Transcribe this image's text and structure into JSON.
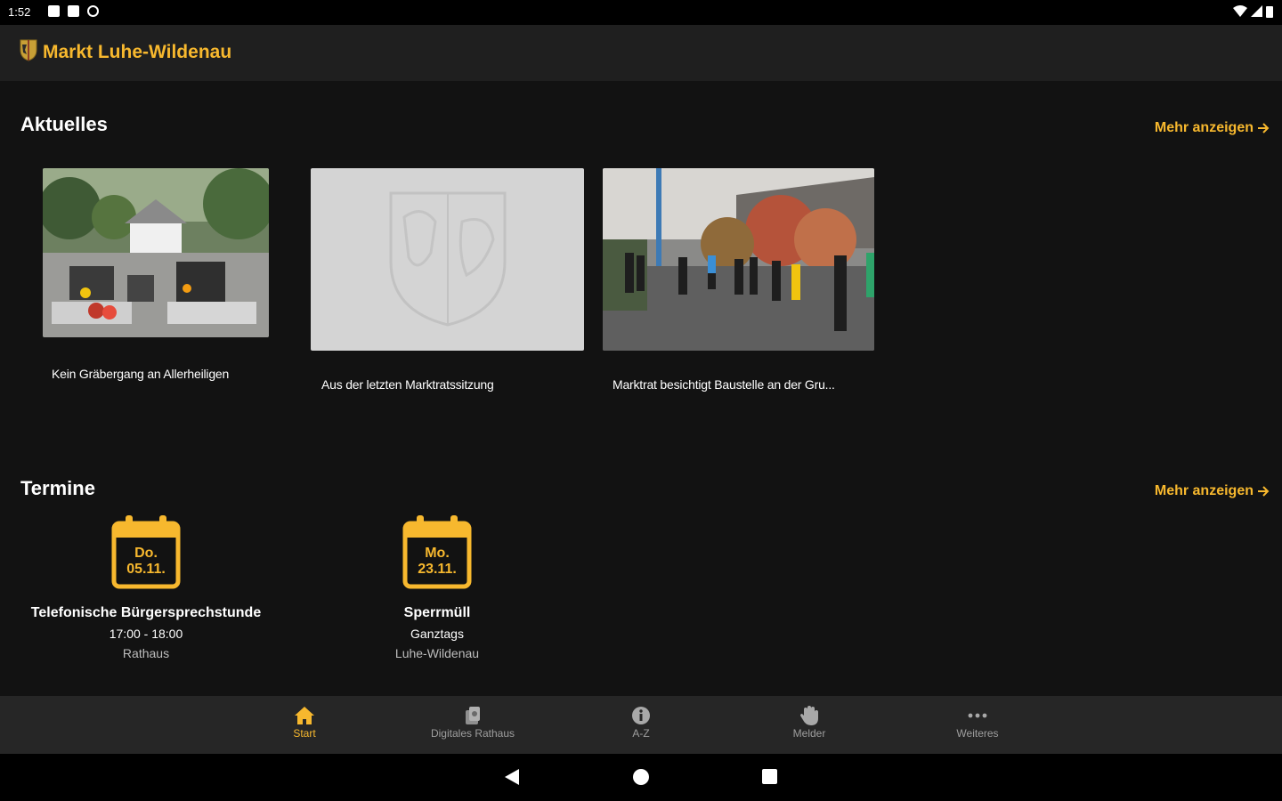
{
  "status_bar": {
    "time": "1:52"
  },
  "app_bar": {
    "title": "Markt Luhe-Wildenau"
  },
  "news": {
    "section_title": "Aktuelles",
    "more_label": "Mehr anzeigen",
    "items": [
      {
        "caption": "Kein Gräbergang an Allerheiligen"
      },
      {
        "caption": "Aus der letzten Marktratssitzung"
      },
      {
        "caption": "Marktrat besichtigt Baustelle an der Gru..."
      }
    ]
  },
  "events": {
    "section_title": "Termine",
    "more_label": "Mehr anzeigen",
    "items": [
      {
        "day": "Do.",
        "date": "05.11.",
        "title": "Telefonische Bürgersprechstunde",
        "time": "17:00 - 18:00",
        "location": "Rathaus"
      },
      {
        "day": "Mo.",
        "date": "23.11.",
        "title": "Sperrmüll",
        "time": "Ganztags",
        "location": "Luhe-Wildenau"
      }
    ]
  },
  "bottom_nav": {
    "items": [
      {
        "label": "Start",
        "icon": "home-icon",
        "active": true
      },
      {
        "label": "Digitales Rathaus",
        "icon": "town-hall-icon",
        "active": false
      },
      {
        "label": "A-Z",
        "icon": "info-icon",
        "active": false
      },
      {
        "label": "Melder",
        "icon": "hand-icon",
        "active": false
      },
      {
        "label": "Weiteres",
        "icon": "more-icon",
        "active": false
      }
    ]
  },
  "colors": {
    "accent": "#f7b82e",
    "background": "#121212",
    "app_bar": "#1f1f1f",
    "bottom_nav": "#262626"
  }
}
